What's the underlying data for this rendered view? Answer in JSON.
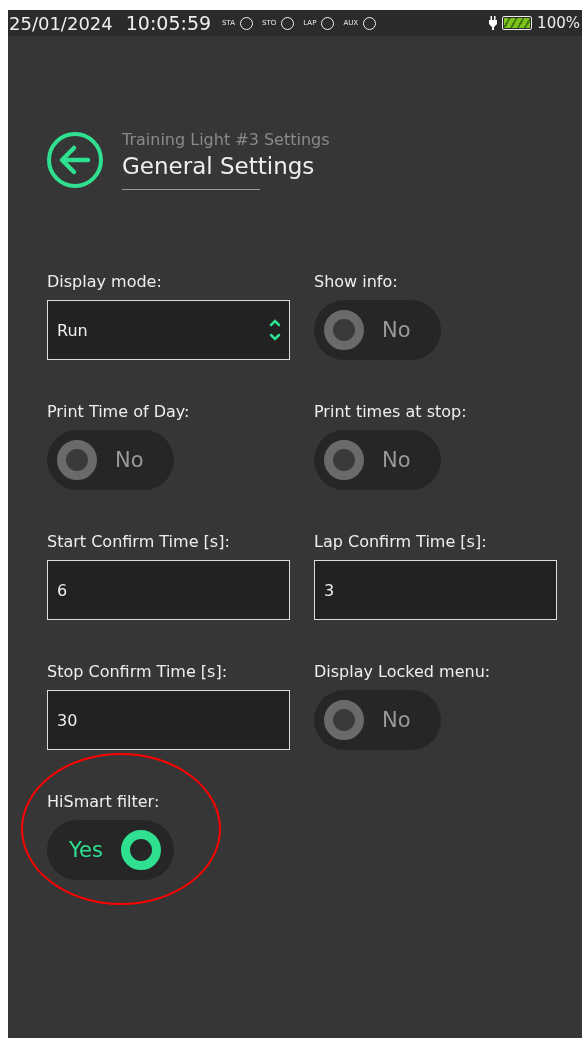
{
  "status_bar": {
    "date": "25/01/2024",
    "time": "10:05:59",
    "indicators": [
      {
        "label": "STA",
        "on": false
      },
      {
        "label": "STO",
        "on": false
      },
      {
        "label": "LAP",
        "on": false
      },
      {
        "label": "AUX",
        "on": false
      }
    ],
    "battery": {
      "level": 1,
      "percent": "100%"
    }
  },
  "header": {
    "subtitle": "Training Light #3 Settings",
    "title": "General Settings"
  },
  "settings": [
    {
      "kind": "select",
      "label": "Display mode:",
      "value": "Run"
    },
    {
      "kind": "toggle",
      "label": "Show info:",
      "on": false,
      "state_text": "No"
    },
    {
      "kind": "toggle",
      "label": "Print Time of Day:",
      "on": false,
      "state_text": "No"
    },
    {
      "kind": "toggle",
      "label": "Print times at stop:",
      "on": false,
      "state_text": "No"
    },
    {
      "kind": "input",
      "label": "Start Confirm Time [s]:",
      "value": "6"
    },
    {
      "kind": "input",
      "label": "Lap Confirm Time [s]:",
      "value": "3"
    },
    {
      "kind": "input",
      "label": "Stop Confirm Time [s]:",
      "value": "30"
    },
    {
      "kind": "toggle",
      "label": "Display Locked menu:",
      "on": false,
      "state_text": "No"
    },
    {
      "kind": "toggle",
      "label": "HiSmart filter:",
      "on": true,
      "state_text": "Yes",
      "highlighted": true
    }
  ]
}
